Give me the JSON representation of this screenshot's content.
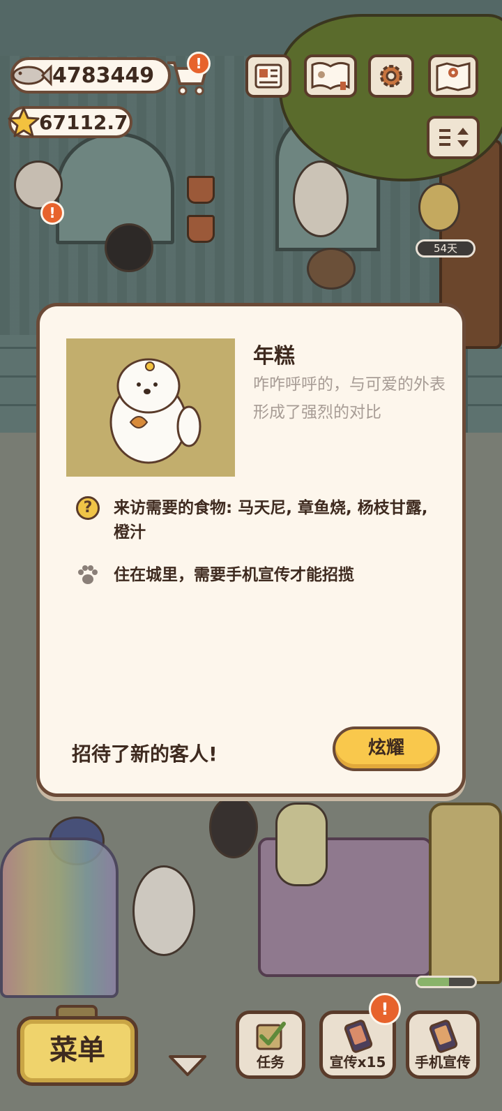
{
  "hud": {
    "fish_count": "4783449",
    "star_count": "67112.7",
    "cart_alert": "!",
    "days_badge": "54天",
    "icons": [
      "newspaper-icon",
      "photo-album-icon",
      "gear-icon",
      "map-icon",
      "sort-toggle-icon"
    ]
  },
  "dialog": {
    "name": "年糕",
    "description": "咋咋呼呼的，与可爱的外表形成了强烈的对比",
    "food_icon": "question-icon",
    "food_text": "来访需要的食物: 马天尼, 章鱼烧, 杨枝甘露, 橙汁",
    "habitat_icon": "paw-icon",
    "habitat_text": "住在城里，需要手机宣传才能招揽",
    "welcome_text": "招待了新的客人!",
    "show_button": "炫耀"
  },
  "bottom_bar": {
    "menu_label": "菜单",
    "tasks_label": "任务",
    "promote_label": "宣传x15",
    "promote_alert": "!",
    "phone_promote_label": "手机宣传",
    "progress_fraction": 0.55
  },
  "colors": {
    "panel_bg": "#fdf6ec",
    "outline": "#6b4a37",
    "button_yellow": "#f9c84c",
    "alert_orange": "#e7632c",
    "portrait_bg": "#c2ae6d"
  }
}
